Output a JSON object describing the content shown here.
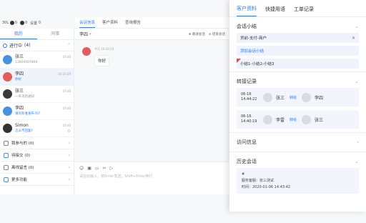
{
  "statusbar": {
    "items": [
      {
        "label": "30L",
        "count": "0"
      },
      {
        "label": "",
        "count": "0"
      },
      {
        "label": "设置",
        "count": "0"
      }
    ]
  },
  "left": {
    "tabs": [
      "我的",
      "同事"
    ],
    "in_progress": {
      "label": "进行中",
      "count": "(4)"
    },
    "conversations": [
      {
        "name": "张三",
        "sub": "13800007890",
        "time": "10:48",
        "badge": "",
        "color": "#4a90e2"
      },
      {
        "name": "李四",
        "sub": "你好",
        "time": "16:20:29",
        "badge": "",
        "color": "#e55b5b"
      },
      {
        "name": "张三",
        "sub": "一条消息通知",
        "time": "10:48",
        "badge": "",
        "color": "#3a3a3a"
      },
      {
        "name": "李四",
        "sub": "请问有谁发布 吗?",
        "time": "10:48",
        "badge": "",
        "color": "#4a90e2"
      },
      {
        "name": "Simon",
        "sub": "怎么不回复?",
        "time": "10:48",
        "badge": "0",
        "color": "#333333"
      }
    ],
    "menu": [
      {
        "label": "我参与的 (0)",
        "color": "#4a90e2"
      },
      {
        "label": "待接交 (0)",
        "color": "#4a90e2"
      },
      {
        "label": "离线留言 (0)",
        "color": "#4a90e2"
      },
      {
        "label": "更多功能",
        "color": "#4a90e2"
      }
    ]
  },
  "center": {
    "tabs": [
      "会话信息",
      "客户资料",
      "查询报告"
    ],
    "chat_title": "李四",
    "actions": [
      "邀请会话",
      "结束会话"
    ],
    "message": {
      "meta": "今天 16:20:29",
      "text": "你好"
    },
    "tools": [
      "☺",
      "▣",
      "▭",
      "✂",
      "▷"
    ],
    "input_placeholder": "请在此输入，按Enter发送，Shift+Enter换行"
  },
  "right": {
    "tabs": [
      "客户资料",
      "快捷用语",
      "工单记录"
    ],
    "summary": {
      "title": "会话小结",
      "tag": "贷前-支付-商户",
      "add_label": "添加会话小结",
      "note": "小结1-小结2-小结3"
    },
    "transfer": {
      "title": "转接记录",
      "records": [
        {
          "date": "06-16",
          "time": "14:44:22",
          "from": "张三",
          "action": "转给",
          "to": "李四"
        },
        {
          "date": "06-16",
          "time": "14:40:19",
          "from": "李雷",
          "action": "转给",
          "to": "张三"
        }
      ]
    },
    "visit": {
      "title": "访问信息"
    },
    "history": {
      "title": "历史会话",
      "id": "#",
      "agent": "服务客服：张三测试",
      "time": "时间：2020-01-06 14:43:42"
    }
  }
}
